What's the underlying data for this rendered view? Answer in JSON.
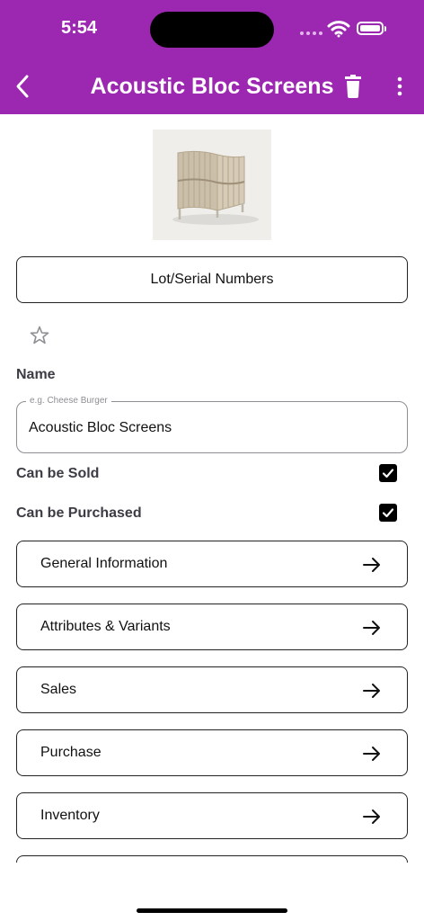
{
  "status_bar": {
    "time": "5:54"
  },
  "header": {
    "title": "Acoustic Bloc Screens",
    "background_color": "#9c27b0",
    "back_icon": "chevron-left-icon",
    "delete_icon": "trash-icon",
    "more_icon": "more-vertical-icon"
  },
  "product": {
    "image_alt": "Acoustic Bloc Screens product photo"
  },
  "lot_button": {
    "label": "Lot/Serial Numbers"
  },
  "favorite": {
    "icon": "star-outline-icon",
    "active": false
  },
  "name_field": {
    "label": "Name",
    "placeholder": "e.g. Cheese Burger",
    "value": "Acoustic Bloc Screens"
  },
  "checkboxes": [
    {
      "label": "Can be Sold",
      "checked": true
    },
    {
      "label": "Can be Purchased",
      "checked": true
    }
  ],
  "sections": [
    {
      "label": "General Information"
    },
    {
      "label": "Attributes & Variants"
    },
    {
      "label": "Sales"
    },
    {
      "label": "Purchase"
    },
    {
      "label": "Inventory"
    }
  ]
}
